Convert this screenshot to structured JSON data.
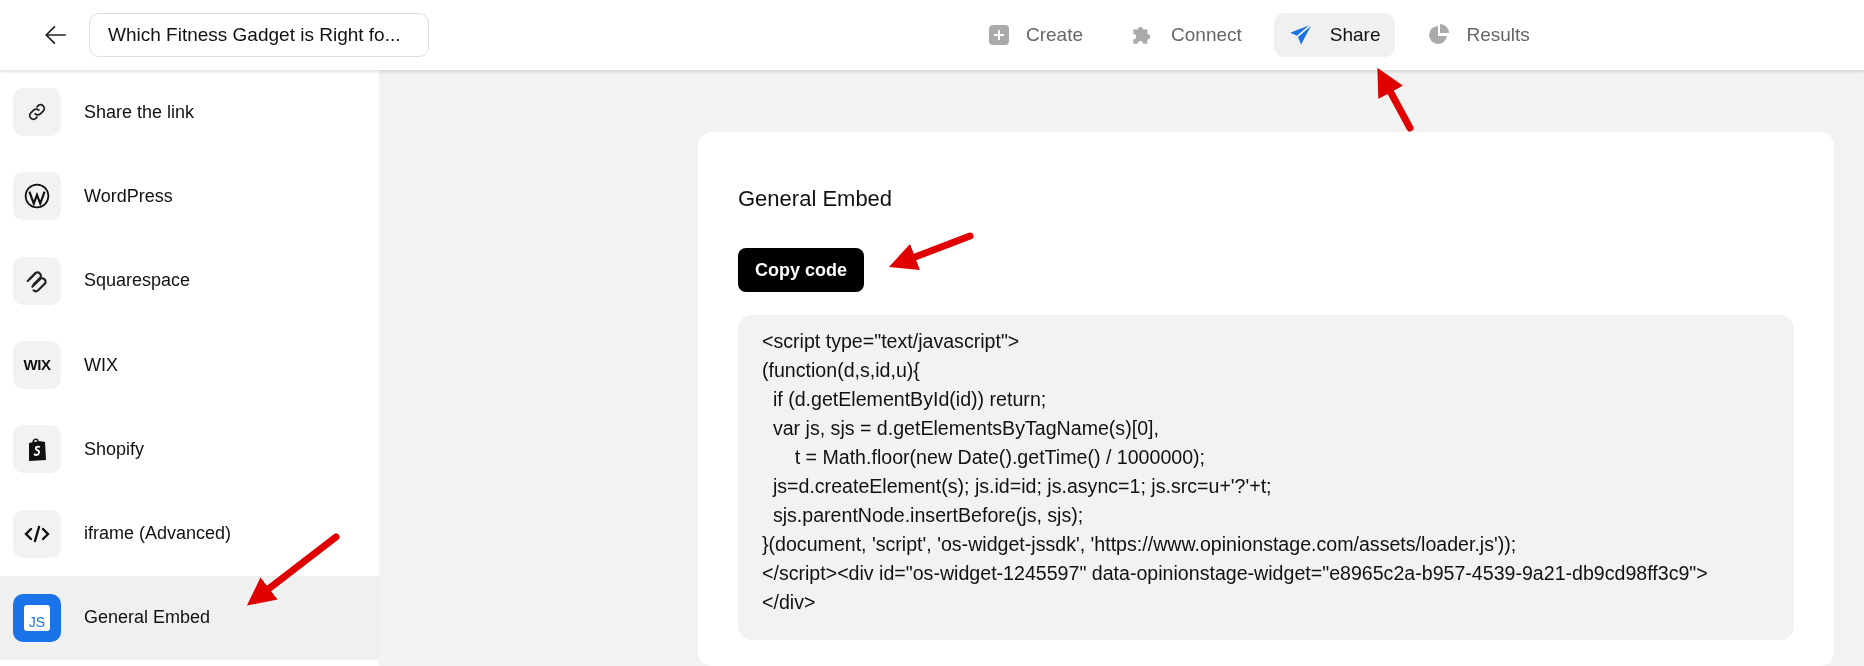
{
  "header": {
    "title_field": {
      "value": "Which Fitness Gadget is Right fo..."
    },
    "tabs": [
      {
        "label": "Create",
        "selected": false
      },
      {
        "label": "Connect",
        "selected": false
      },
      {
        "label": "Share",
        "selected": true
      },
      {
        "label": "Results",
        "selected": false
      }
    ]
  },
  "sidebar": {
    "items": [
      {
        "label": "Share the link",
        "selected": false
      },
      {
        "label": "WordPress",
        "selected": false
      },
      {
        "label": "Squarespace",
        "selected": false
      },
      {
        "label": "WIX",
        "icon_text": "WIX",
        "selected": false
      },
      {
        "label": "Shopify",
        "selected": false
      },
      {
        "label": "iframe (Advanced)",
        "selected": false
      },
      {
        "label": "General Embed",
        "icon_text": "JS",
        "selected": true
      }
    ]
  },
  "panel": {
    "title": "General Embed",
    "copy_button": "Copy code",
    "code": "<script type=\"text/javascript\">\n(function(d,s,id,u){\n  if (d.getElementById(id)) return;\n  var js, sjs = d.getElementsByTagName(s)[0],\n      t = Math.floor(new Date().getTime() / 1000000);\n  js=d.createElement(s); js.id=id; js.async=1; js.src=u+'?'+t;\n  sjs.parentNode.insertBefore(js, sjs);\n}(document, 'script', 'os-widget-jssdk', 'https://www.opinionstage.com/assets/loader.js'));\n</script><div id=\"os-widget-1245597\" data-opinionstage-widget=\"e8965c2a-b957-4539-9a21-db9cd98ff3c9\"></div>"
  }
}
